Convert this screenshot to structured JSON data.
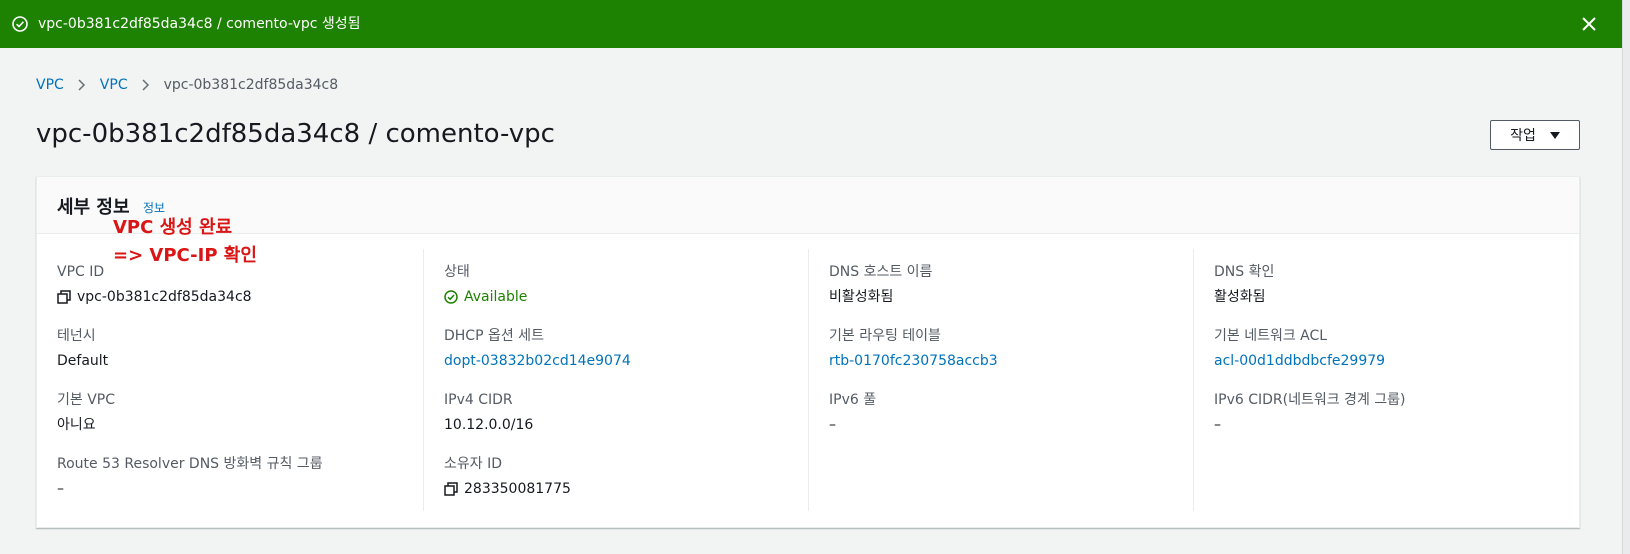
{
  "flash": {
    "message": "vpc-0b381c2df85da34c8 / comento-vpc 생성됨",
    "color": "#1d8102"
  },
  "breadcrumb": {
    "items": [
      "VPC",
      "VPC"
    ],
    "current": "vpc-0b381c2df85da34c8"
  },
  "page": {
    "title": "vpc-0b381c2df85da34c8 / comento-vpc",
    "actions_label": "작업"
  },
  "panel": {
    "title": "세부 정보",
    "info_link": "정보"
  },
  "annotation": {
    "line1": "VPC 생성 완료",
    "line2": "=> VPC-IP 확인",
    "color": "#d91515"
  },
  "details": {
    "col1": [
      {
        "label": "VPC ID",
        "value": "vpc-0b381c2df85da34c8"
      },
      {
        "label": "테넌시",
        "value": "Default"
      },
      {
        "label": "기본 VPC",
        "value": "아니요"
      },
      {
        "label": "Route 53 Resolver DNS 방화벽 규칙 그룹",
        "value": "–"
      }
    ],
    "col2": [
      {
        "label": "상태",
        "value": "Available"
      },
      {
        "label": "DHCP 옵션 세트",
        "value": "dopt-03832b02cd14e9074"
      },
      {
        "label": "IPv4 CIDR",
        "value": "10.12.0.0/16"
      },
      {
        "label": "소유자 ID",
        "value": "283350081775"
      }
    ],
    "col3": [
      {
        "label": "DNS 호스트 이름",
        "value": "비활성화됨"
      },
      {
        "label": "기본 라우팅 테이블",
        "value": "rtb-0170fc230758accb3"
      },
      {
        "label": "IPv6 풀",
        "value": "–"
      }
    ],
    "col4": [
      {
        "label": "DNS 확인",
        "value": "활성화됨"
      },
      {
        "label": "기본 네트워크 ACL",
        "value": "acl-00d1ddbdbcfe29979"
      },
      {
        "label": "IPv6 CIDR(네트워크 경계 그룹)",
        "value": "–"
      }
    ]
  },
  "colors": {
    "link": "#0073bb",
    "success": "#1d8102",
    "background": "#f2f3f3"
  }
}
